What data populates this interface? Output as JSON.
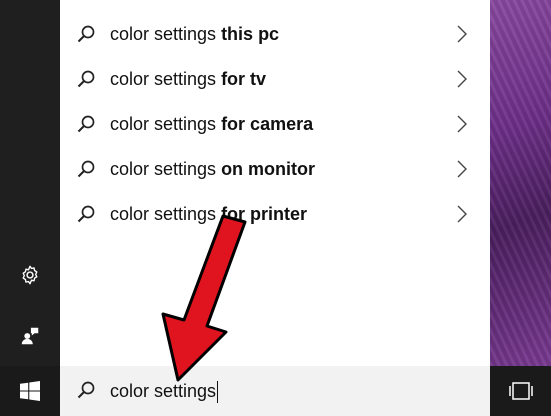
{
  "results": [
    {
      "prefix": "color settings ",
      "suffix": "this pc"
    },
    {
      "prefix": "color settings ",
      "suffix": "for tv"
    },
    {
      "prefix": "color settings ",
      "suffix": "for camera"
    },
    {
      "prefix": "color settings ",
      "suffix": "on monitor"
    },
    {
      "prefix": "color settings ",
      "suffix": "for printer"
    }
  ],
  "search": {
    "value": "color settings"
  },
  "icons": {
    "result": "search-icon",
    "chevron": "chevron-right-icon",
    "rail_top": "settings-gear-icon",
    "rail_bottom": "feedback-icon",
    "start": "windows-logo-icon",
    "taskbar_right": "task-view-icon"
  },
  "colors": {
    "annotation_arrow": "#e0141e",
    "panel": "#ffffff",
    "rail": "#1f1f1f"
  }
}
